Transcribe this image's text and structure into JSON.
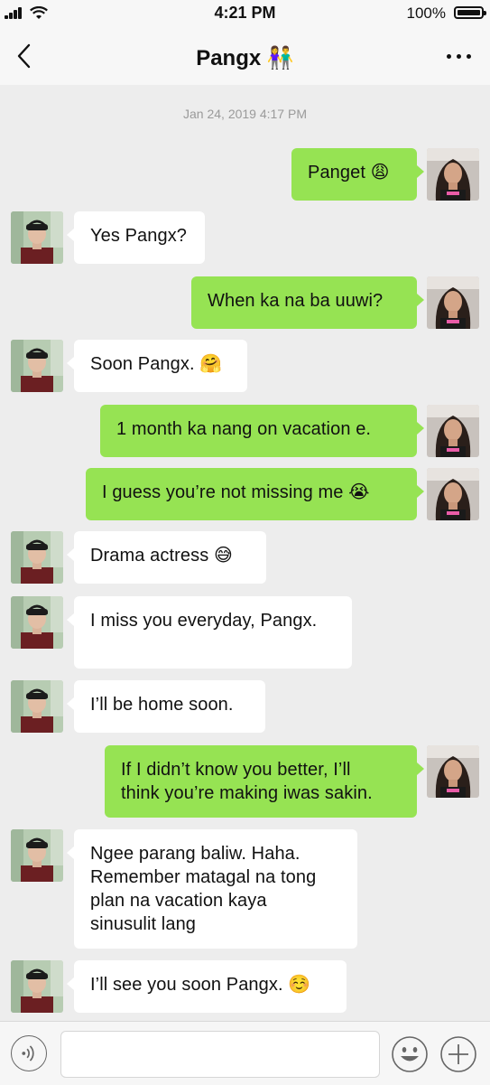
{
  "status": {
    "time": "4:21 PM",
    "battery": "100%"
  },
  "header": {
    "title": "Pangx 👫"
  },
  "timestamp": "Jan 24, 2019 4:17 PM",
  "avatars": {
    "me": "avatar-girl",
    "other": "avatar-boy-cap"
  },
  "colors": {
    "outgoing": "#96e353",
    "incoming": "#ffffff",
    "background": "#ededed"
  },
  "messages": [
    {
      "from": "me",
      "lines": [
        "Panget 😩"
      ]
    },
    {
      "from": "other",
      "lines": [
        "Yes Pangx?"
      ]
    },
    {
      "from": "me",
      "lines": [
        "When ka na ba uuwi?"
      ]
    },
    {
      "from": "other",
      "lines": [
        "Soon Pangx. 🤗"
      ]
    },
    {
      "from": "me",
      "lines": [
        "1 month ka nang on vacation e."
      ]
    },
    {
      "from": "me",
      "lines": [
        "I guess you’re not missing me 😭"
      ]
    },
    {
      "from": "other",
      "lines": [
        "Drama actress 😅"
      ]
    },
    {
      "from": "other",
      "lines": [
        "I miss you everyday, Pangx.",
        ""
      ]
    },
    {
      "from": "other",
      "lines": [
        "I’ll be home soon."
      ]
    },
    {
      "from": "me",
      "lines": [
        "If I didn’t know you better, I’ll",
        "think you’re making iwas sakin."
      ]
    },
    {
      "from": "other",
      "lines": [
        "Ngee parang baliw. Haha.",
        "Remember matagal na tong",
        "plan na vacation kaya",
        "sinusulit lang"
      ]
    },
    {
      "from": "other",
      "lines": [
        "I’ll see you soon Pangx. ☺️"
      ]
    }
  ],
  "input": {
    "placeholder": ""
  }
}
